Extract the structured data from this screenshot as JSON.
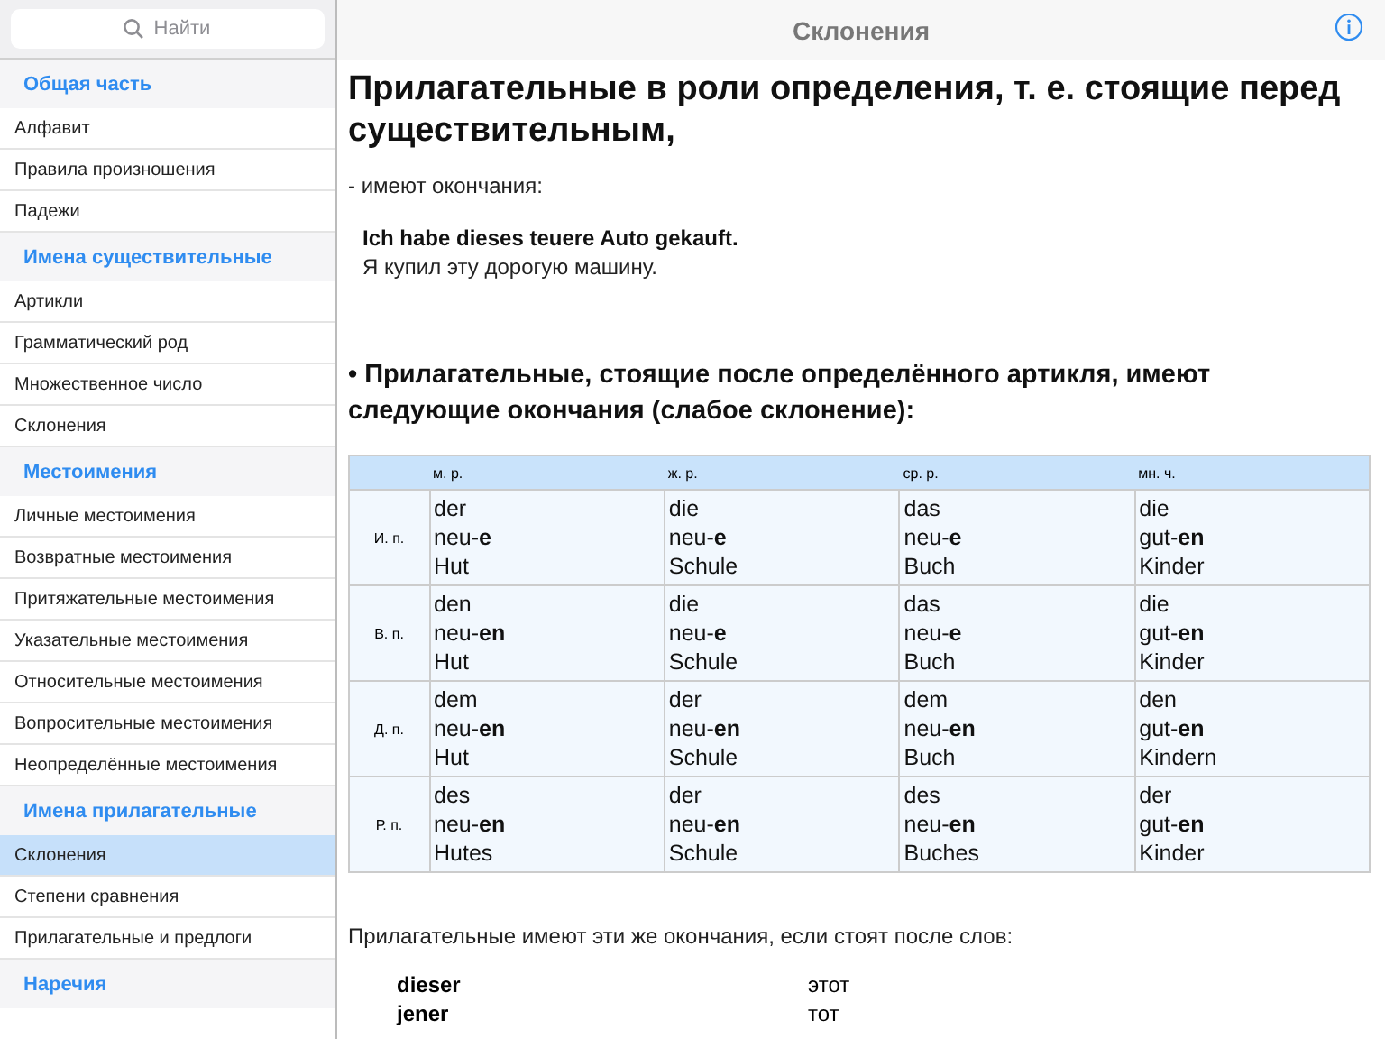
{
  "sidebar": {
    "search": {
      "placeholder": "Найти"
    },
    "sections": [
      {
        "title": "Общая часть",
        "items": [
          {
            "label": "Алфавит",
            "selected": false
          },
          {
            "label": "Правила произношения",
            "selected": false
          },
          {
            "label": "Падежи",
            "selected": false
          }
        ]
      },
      {
        "title": "Имена существительные",
        "items": [
          {
            "label": "Артикли",
            "selected": false
          },
          {
            "label": "Грамматический род",
            "selected": false
          },
          {
            "label": "Множественное число",
            "selected": false
          },
          {
            "label": "Склонения",
            "selected": false
          }
        ]
      },
      {
        "title": "Местоимения",
        "items": [
          {
            "label": "Личные местоимения",
            "selected": false
          },
          {
            "label": "Возвратные местоимения",
            "selected": false
          },
          {
            "label": "Притяжательные местоимения",
            "selected": false
          },
          {
            "label": "Указательные местоимения",
            "selected": false
          },
          {
            "label": "Относительные местоимения",
            "selected": false
          },
          {
            "label": "Вопросительные местоимения",
            "selected": false
          },
          {
            "label": "Неопределённые местоимения",
            "selected": false
          }
        ]
      },
      {
        "title": "Имена прилагательные",
        "items": [
          {
            "label": "Склонения",
            "selected": true
          },
          {
            "label": "Степени сравнения",
            "selected": false
          },
          {
            "label": "Прилагательные и предлоги",
            "selected": false
          }
        ]
      },
      {
        "title": "Наречия"
      }
    ]
  },
  "header": {
    "title": "Склонения"
  },
  "content": {
    "heading": "Прилагательные в роли определения, т. е. стоящие перед существительным,",
    "intro": "- имеют окончания:",
    "example": {
      "german": "Ich habe dieses teuere Auto gekauft.",
      "translation": "Я купил эту дорогую машину."
    },
    "subheading": "• Прилагательные, стоящие после определённого артикля, имеют следующие окончания (слабое склонение):",
    "table": {
      "columns": [
        "м. р.",
        "ж. р.",
        "ср. р.",
        "мн. ч."
      ],
      "rows": [
        {
          "case": "И. п.",
          "cells": [
            [
              "der",
              "neu-**e**",
              "Hut"
            ],
            [
              "die",
              "neu-**e**",
              "Schule"
            ],
            [
              "das",
              "neu-**e**",
              "Buch"
            ],
            [
              "die",
              "gut-**en**",
              "Kinder"
            ]
          ]
        },
        {
          "case": "В. п.",
          "cells": [
            [
              "den",
              "neu-**en**",
              "Hut"
            ],
            [
              "die",
              "neu-**e**",
              "Schule"
            ],
            [
              "das",
              "neu-**e**",
              "Buch"
            ],
            [
              "die",
              "gut-**en**",
              "Kinder"
            ]
          ]
        },
        {
          "case": "Д. п.",
          "cells": [
            [
              "dem",
              "neu-**en**",
              "Hut"
            ],
            [
              "der",
              "neu-**en**",
              "Schule"
            ],
            [
              "dem",
              "neu-**en**",
              "Buch"
            ],
            [
              "den",
              "gut-**en**",
              "Kindern"
            ]
          ]
        },
        {
          "case": "Р. п.",
          "cells": [
            [
              "des",
              "neu-**en**",
              "Hutes"
            ],
            [
              "der",
              "neu-**en**",
              "Schule"
            ],
            [
              "des",
              "neu-**en**",
              "Buches"
            ],
            [
              "der",
              "gut-**en**",
              "Kinder"
            ]
          ]
        }
      ]
    },
    "note": "Прилагательные имеют эти же окончания, если стоят после слов:",
    "words": [
      {
        "german": "dieser",
        "translation": "этот"
      },
      {
        "german": "jener",
        "translation": "тот"
      }
    ]
  }
}
